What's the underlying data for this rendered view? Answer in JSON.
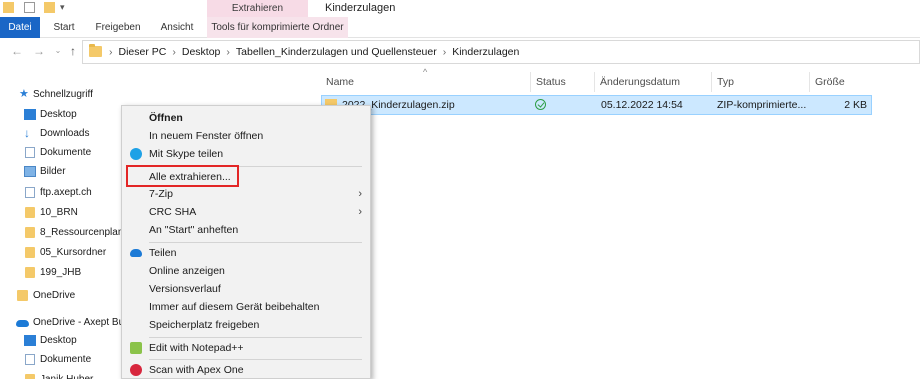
{
  "ribbon": {
    "context_tab_header": "Extrahieren",
    "window_title": "Kinderzulagen",
    "tabs": [
      "Datei",
      "Start",
      "Freigeben",
      "Ansicht",
      "Tools für komprimierte Ordner"
    ]
  },
  "address": {
    "crumbs": [
      "Dieser PC",
      "Desktop",
      "Tabellen_Kinderzulagen und Quellensteuer",
      "Kinderzulagen"
    ]
  },
  "nav": {
    "items": [
      {
        "label": "Schnellzugriff",
        "icon": "star-icon"
      },
      {
        "label": "Desktop",
        "icon": "desktop-icon"
      },
      {
        "label": "Downloads",
        "icon": "download-icon"
      },
      {
        "label": "Dokumente",
        "icon": "documents-icon"
      },
      {
        "label": "Bilder",
        "icon": "pictures-icon"
      },
      {
        "label": "ftp.axept.ch",
        "icon": "folder-icon"
      },
      {
        "label": "10_BRN",
        "icon": "folder-icon"
      },
      {
        "label": "8_Ressourcenplanu",
        "icon": "folder-icon"
      },
      {
        "label": "05_Kursordner",
        "icon": "folder-icon"
      },
      {
        "label": "199_JHB",
        "icon": "folder-icon"
      },
      {
        "label": "OneDrive",
        "icon": "folder-icon"
      },
      {
        "label": "OneDrive - Axept Bu",
        "icon": "cloud-icon"
      },
      {
        "label": "Desktop",
        "icon": "desktop-icon"
      },
      {
        "label": "Dokumente",
        "icon": "documents-icon"
      },
      {
        "label": "Janik Huber",
        "icon": "folder-icon"
      }
    ]
  },
  "columns": {
    "name": "Name",
    "status": "Status",
    "date": "Änderungsdatum",
    "type": "Typ",
    "size": "Größe"
  },
  "file": {
    "name": "2022_Kinderzulagen.zip",
    "date": "05.12.2022 14:54",
    "type": "ZIP-komprimierte...",
    "size": "2 KB"
  },
  "context_menu": {
    "items": [
      {
        "label": "Öffnen",
        "bold": true
      },
      {
        "label": "In neuem Fenster öffnen"
      },
      {
        "label": "Mit Skype teilen",
        "icon": "skype-icon"
      },
      {
        "label": "Alle extrahieren..."
      },
      {
        "label": "7-Zip",
        "submenu": true
      },
      {
        "label": "CRC SHA",
        "submenu": true
      },
      {
        "label": "An \"Start\" anheften"
      },
      {
        "label": "Teilen",
        "icon": "onedrive-icon"
      },
      {
        "label": "Online anzeigen"
      },
      {
        "label": "Versionsverlauf"
      },
      {
        "label": "Immer auf diesem Gerät beibehalten"
      },
      {
        "label": "Speicherplatz freigeben"
      },
      {
        "label": "Edit with Notepad++",
        "icon": "notepadpp-icon"
      },
      {
        "label": "Scan with Apex One",
        "icon": "apex-one-icon"
      }
    ],
    "submenu_glyph": "›"
  },
  "colors": {
    "accent": "#1a66c6",
    "selection": "#cce8ff",
    "highlight_box": "#e32626",
    "context_tab": "#f7dbe6"
  }
}
